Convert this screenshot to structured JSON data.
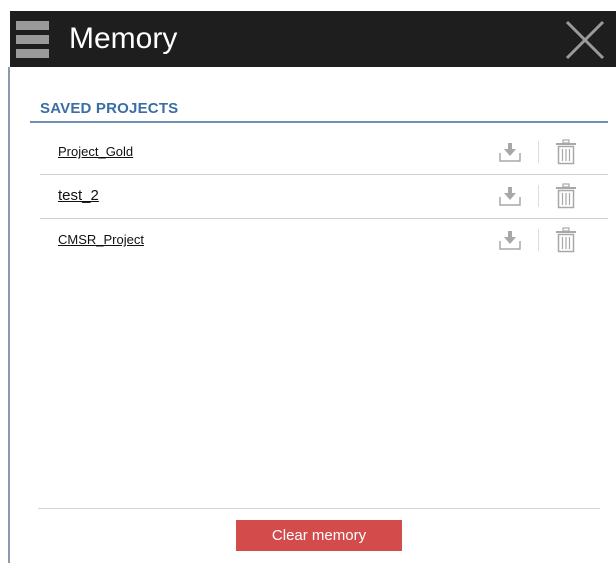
{
  "window": {
    "title": "Memory",
    "menu_icon": "hamburger-menu-icon",
    "close_icon": "close-icon"
  },
  "section": {
    "header": "SAVED PROJECTS"
  },
  "projects": [
    {
      "name": "Project_Gold",
      "download_icon": "download-icon",
      "delete_icon": "trash-icon"
    },
    {
      "name": "test_2",
      "download_icon": "download-icon",
      "delete_icon": "trash-icon"
    },
    {
      "name": "CMSR_Project",
      "download_icon": "download-icon",
      "delete_icon": "trash-icon"
    }
  ],
  "footer": {
    "clear_label": "Clear memory"
  },
  "colors": {
    "titlebar_bg": "#1e1e1e",
    "section_header": "#3a6ea5",
    "clear_button_bg": "#d34b4b",
    "icon_gray": "#9a9a9a"
  }
}
